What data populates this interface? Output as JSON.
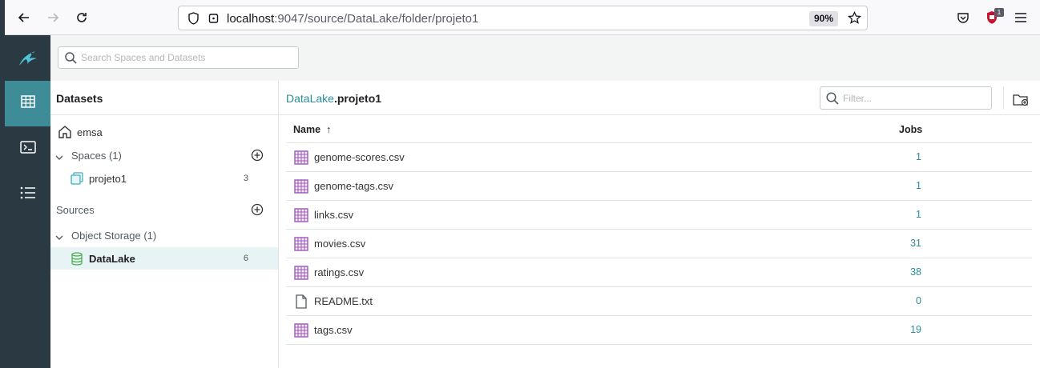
{
  "browser": {
    "url_host": "localhost",
    "url_rest": ":9047/source/DataLake/folder/projeto1",
    "zoom": "90%",
    "extension_badge": "1",
    "icons": [
      "back-arrow-icon",
      "forward-arrow-icon",
      "reload-icon",
      "shield-icon",
      "lock-icon",
      "star-icon",
      "pocket-icon",
      "ublock-icon",
      "hamburger-menu-icon"
    ]
  },
  "search": {
    "placeholder": "Search Spaces and Datasets"
  },
  "nav": {
    "icons": [
      "dremio-logo",
      "datasets-grid-icon",
      "sql-terminal-icon",
      "jobs-list-icon"
    ],
    "active": "datasets"
  },
  "datasets_panel": {
    "title": "Datasets",
    "home": "emsa",
    "spaces_label": "Spaces (1)",
    "spaces": [
      {
        "label": "projeto1",
        "count": "3"
      }
    ],
    "sources_label": "Sources",
    "object_storage_label": "Object Storage (1)",
    "object_storage": [
      {
        "label": "DataLake",
        "count": "6"
      }
    ]
  },
  "main": {
    "breadcrumb_parent": "DataLake",
    "breadcrumb_sep": ".",
    "breadcrumb_current": "projeto1",
    "filter_placeholder": "Filter...",
    "columns": {
      "name": "Name",
      "name_sort": "↑",
      "jobs": "Jobs"
    },
    "rows": [
      {
        "name": "genome-scores.csv",
        "type": "dataset",
        "jobs": "1"
      },
      {
        "name": "genome-tags.csv",
        "type": "dataset",
        "jobs": "1"
      },
      {
        "name": "links.csv",
        "type": "dataset",
        "jobs": "1"
      },
      {
        "name": "movies.csv",
        "type": "dataset",
        "jobs": "31"
      },
      {
        "name": "ratings.csv",
        "type": "dataset",
        "jobs": "38"
      },
      {
        "name": "README.txt",
        "type": "file",
        "jobs": "0"
      },
      {
        "name": "tags.csv",
        "type": "dataset",
        "jobs": "19"
      }
    ]
  },
  "colors": {
    "accent": "#2c8c99",
    "nav_bg": "#2b3a42",
    "nav_active": "#3d8c97",
    "dataset_icon": "#9b59b6",
    "space_icon": "#3aaebd",
    "source_icon": "#4caf50"
  }
}
